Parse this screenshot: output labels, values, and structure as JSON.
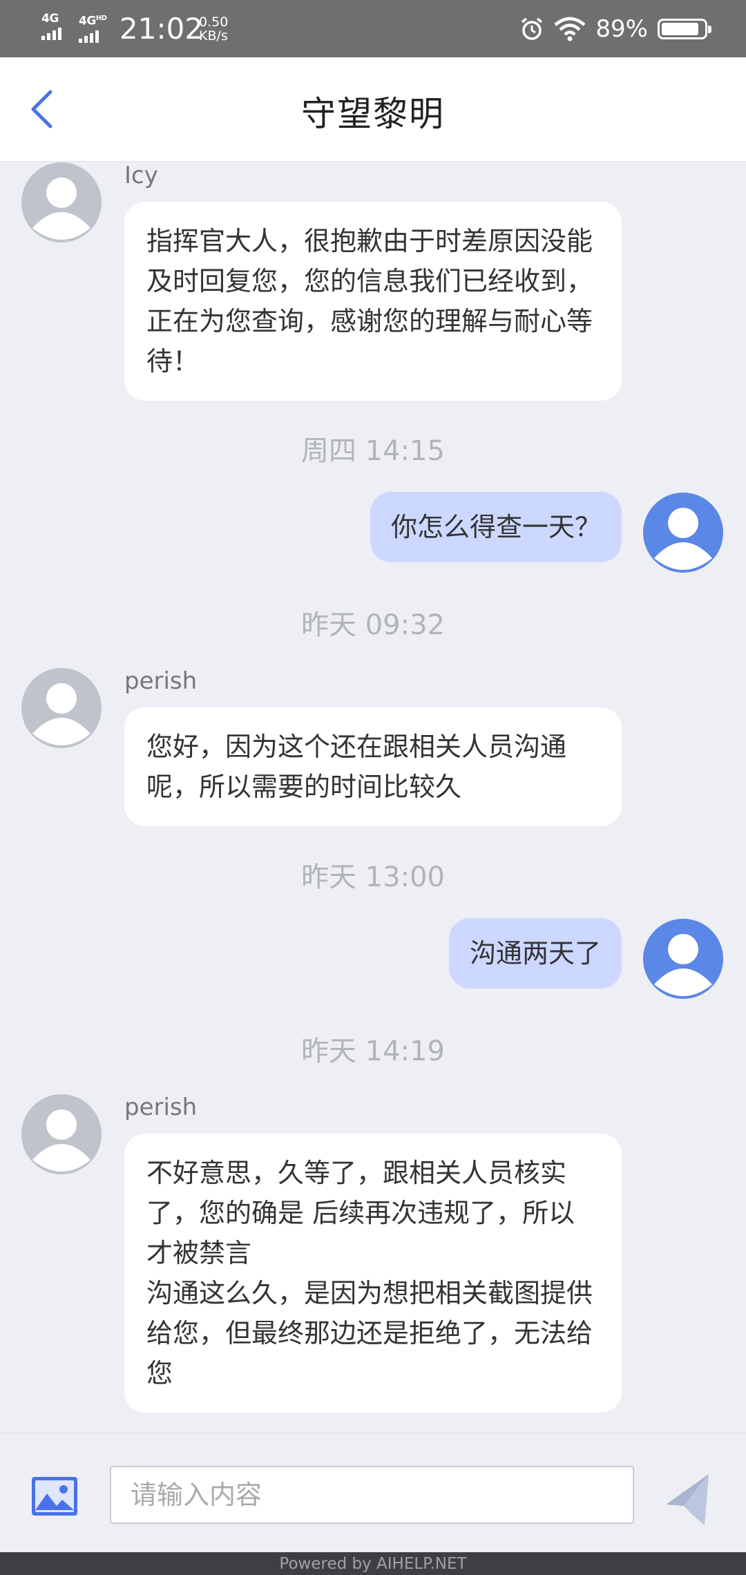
{
  "status_bar": {
    "network_1": "4G",
    "network_2": "4G",
    "network_2_suffix": "HD",
    "time": "21:02",
    "speed_value": "0.50",
    "speed_unit": "KB/s",
    "battery_percent": "89%",
    "battery_level": 0.89
  },
  "header": {
    "title": "守望黎明",
    "back_icon": "chevron-left-icon"
  },
  "messages": [
    {
      "type": "incoming",
      "sender": "Icy",
      "text": "指挥官大人，很抱歉由于时差原因没能及时回复您，您的信息我们已经收到，正在为您查询，感谢您的理解与耐心等待！"
    },
    {
      "type": "timestamp",
      "text": "周四 14:15"
    },
    {
      "type": "outgoing",
      "text": "你怎么得查一天？"
    },
    {
      "type": "timestamp",
      "text": "昨天 09:32"
    },
    {
      "type": "incoming",
      "sender": "perish",
      "text": "您好，因为这个还在跟相关人员沟通呢，所以需要的时间比较久"
    },
    {
      "type": "timestamp",
      "text": "昨天 13:00"
    },
    {
      "type": "outgoing",
      "text": "沟通两天了"
    },
    {
      "type": "timestamp",
      "text": "昨天 14:19"
    },
    {
      "type": "incoming",
      "sender": "perish",
      "text": "不好意思，久等了，跟相关人员核实了，您的确是 后续再次违规了，所以才被禁言\n沟通这么久，是因为想把相关截图提供给您，但最终那边还是拒绝了，无法给您"
    }
  ],
  "input_bar": {
    "placeholder": "请输入内容",
    "value": "",
    "image_icon": "image-icon",
    "send_icon": "send-icon"
  },
  "footer": {
    "text": "Powered by AIHELP.NET"
  },
  "colors": {
    "accent": "#4a72e8",
    "outgoing_bubble": "#ccd8ff",
    "incoming_bubble": "#ffffff",
    "background": "#eeeff5",
    "status_bar": "#6e6f71"
  }
}
